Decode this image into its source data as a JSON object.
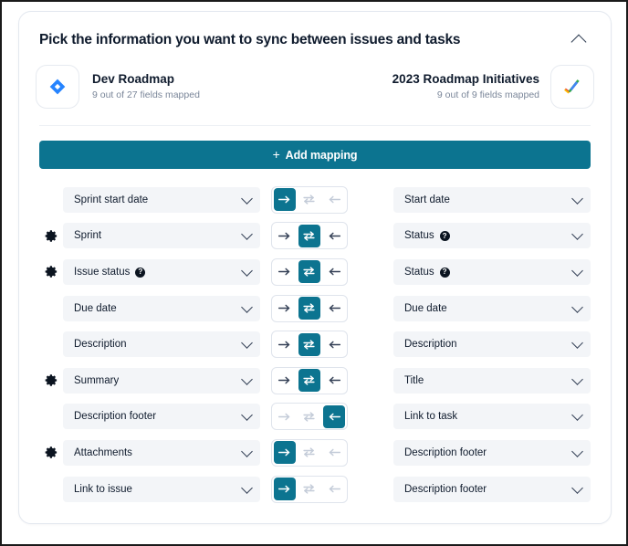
{
  "header": {
    "title": "Pick the information you want to sync between issues and tasks",
    "collapse_icon": "chevron-up-icon"
  },
  "apps": {
    "left": {
      "icon": "jira-diamond-icon",
      "name": "Dev Roadmap",
      "fields_mapped": "9 out of 27 fields mapped"
    },
    "right": {
      "icon": "google-tasks-check-icon",
      "name": "2023 Roadmap Initiatives",
      "fields_mapped": "9 out of 9 fields mapped"
    }
  },
  "toolbar": {
    "add_mapping_label": "Add mapping",
    "add_mapping_plus": "+"
  },
  "colors": {
    "accent_teal": "#0c7490",
    "field_bg": "#f3f5f8",
    "card_border": "#e3e8ef",
    "muted_text": "#7a8699"
  },
  "direction_options": [
    {
      "key": "right",
      "icon": "arrow-right-icon",
      "title": "Sync left to right"
    },
    {
      "key": "both",
      "icon": "arrows-bidirectional-icon",
      "title": "Sync both ways"
    },
    {
      "key": "left",
      "icon": "arrow-left-icon",
      "title": "Sync right to left"
    }
  ],
  "mappings": [
    {
      "gear": false,
      "left_field": "Sprint start date",
      "left_help": false,
      "direction": "right",
      "right_field": "Start date",
      "right_help": false
    },
    {
      "gear": true,
      "left_field": "Sprint",
      "left_help": false,
      "direction": "both",
      "right_field": "Status",
      "right_help": true
    },
    {
      "gear": true,
      "left_field": "Issue status",
      "left_help": true,
      "direction": "both",
      "right_field": "Status",
      "right_help": true
    },
    {
      "gear": false,
      "left_field": "Due date",
      "left_help": false,
      "direction": "both",
      "right_field": "Due date",
      "right_help": false
    },
    {
      "gear": false,
      "left_field": "Description",
      "left_help": false,
      "direction": "both",
      "right_field": "Description",
      "right_help": false
    },
    {
      "gear": true,
      "left_field": "Summary",
      "left_help": false,
      "direction": "both",
      "right_field": "Title",
      "right_help": false
    },
    {
      "gear": false,
      "left_field": "Description footer",
      "left_help": false,
      "direction": "left",
      "right_field": "Link to task",
      "right_help": false
    },
    {
      "gear": true,
      "left_field": "Attachments",
      "left_help": false,
      "direction": "right",
      "right_field": "Description footer",
      "right_help": false
    },
    {
      "gear": false,
      "left_field": "Link to issue",
      "left_help": false,
      "direction": "right",
      "right_field": "Description footer",
      "right_help": false
    }
  ]
}
